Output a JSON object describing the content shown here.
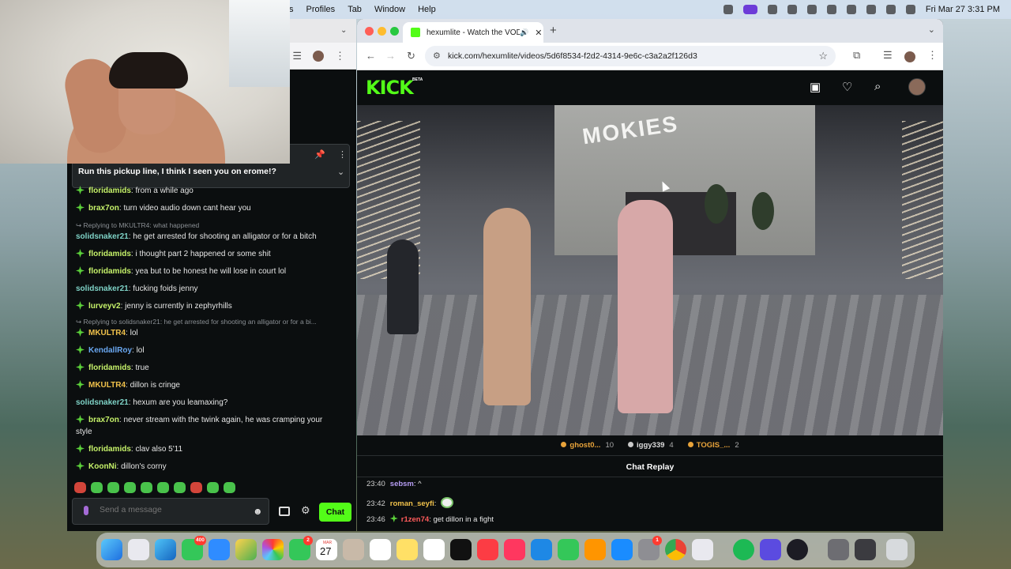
{
  "menubar": {
    "menus": [
      "s",
      "Profiles",
      "Tab",
      "Window",
      "Help"
    ],
    "datetime": "Fri Mar 27  3:31 PM"
  },
  "left_chat": {
    "pinned_message": "Run this pickup line, I think I seen you on erome!?",
    "messages": [
      {
        "user": "floridamids",
        "user_color": "#c6f26a",
        "text": "from a while ago",
        "badge": true
      },
      {
        "user": "brax7on",
        "user_color": "#c6f26a",
        "text": "turn video audio down cant hear you",
        "badge": true
      },
      {
        "reply": "Replying to MKULTR4: what happened"
      },
      {
        "user": "solidsnaker21",
        "user_color": "#7fd3c7",
        "text": "he get arrested for shooting an alligator or for a bitch",
        "badge": false
      },
      {
        "user": "floridamids",
        "user_color": "#c6f26a",
        "text": "i thought part 2 happened or some shit",
        "badge": true
      },
      {
        "user": "floridamids",
        "user_color": "#c6f26a",
        "text": "yea but to be honest he will lose in court lol",
        "badge": true
      },
      {
        "user": "solidsnaker21",
        "user_color": "#7fd3c7",
        "text": "fucking foids jenny",
        "badge": false
      },
      {
        "user": "lurveyv2",
        "user_color": "#c6f26a",
        "text": "jenny is currently in zephyrhills",
        "badge": true
      },
      {
        "reply": "Replying to solidsnaker21: he get arrested for shooting an alligator or for a bi..."
      },
      {
        "user": "MKULTR4",
        "user_color": "#f0c14b",
        "text": "lol",
        "badge": true
      },
      {
        "user": "KendallRoy",
        "user_color": "#6aa8f2",
        "text": "lol",
        "badge": true
      },
      {
        "user": "floridamids",
        "user_color": "#c6f26a",
        "text": "true",
        "badge": true
      },
      {
        "user": "MKULTR4",
        "user_color": "#f0c14b",
        "text": "dillon is cringe",
        "badge": true
      },
      {
        "user": "solidsnaker21",
        "user_color": "#7fd3c7",
        "text": "hexum are you leamaxing?",
        "badge": false
      },
      {
        "user": "brax7on",
        "user_color": "#c6f26a",
        "text": "never stream with the twink again, he was cramping your",
        "continuation": "style",
        "badge": true
      },
      {
        "user": "floridamids",
        "user_color": "#c6f26a",
        "text": "clav also 5'11",
        "badge": true
      },
      {
        "user": "KoonNi",
        "user_color": "#c6f26a",
        "text": "dillon's corny",
        "badge": true
      }
    ],
    "input_placeholder": "Send a message",
    "chat_button": "Chat"
  },
  "browser": {
    "tab_title": "hexumlite - Watch the VOD",
    "url": "kick.com/hexumlite/videos/5d6f8534-f2d2-4314-9e6c-c3a2a2f126d3"
  },
  "kick": {
    "logo": "KICK",
    "beta": "BETA",
    "brand_color": "#53fc18",
    "video_sign": "MOKIES",
    "leaderboard": [
      {
        "name": "ghost0...",
        "count": "10",
        "coin": "gold"
      },
      {
        "name": "iggy339",
        "count": "4",
        "coin": "silver"
      },
      {
        "name": "TOGIS_...",
        "count": "2",
        "coin": "gold"
      }
    ],
    "replay_title": "Chat Replay",
    "replay_messages": [
      {
        "time": "23:40",
        "user": "sebsm",
        "user_color": "#b59cf2",
        "text": "^",
        "badge": false,
        "emoji": false
      },
      {
        "time": "23:42",
        "user": "roman_seyfi",
        "user_color": "#f0c14b",
        "text": "",
        "badge": false,
        "emoji": true
      },
      {
        "time": "23:46",
        "user": "r1zen74",
        "user_color": "#ff5b5b",
        "text": "get dillon in a fight",
        "badge": true,
        "emoji": false
      }
    ]
  },
  "dock": {
    "messages_badge": "400",
    "facetime_badge": "2",
    "calendar_month": "MAR",
    "calendar_day": "27",
    "settings_badge": "1"
  }
}
